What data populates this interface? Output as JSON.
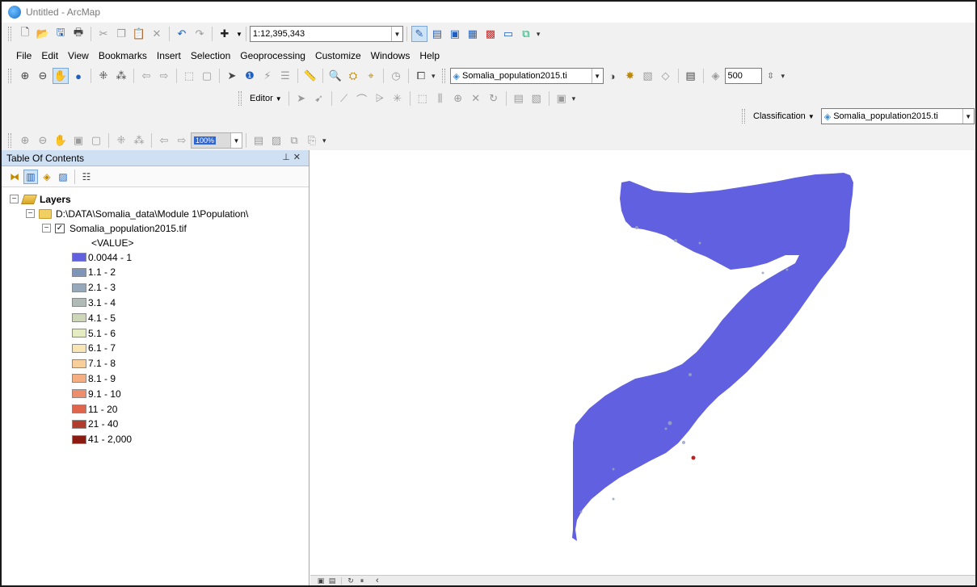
{
  "window": {
    "title": "Untitled - ArcMap"
  },
  "standard_toolbar": {
    "scale_value": "1:12,395,343"
  },
  "menu": {
    "items": [
      "File",
      "Edit",
      "View",
      "Bookmarks",
      "Insert",
      "Selection",
      "Geoprocessing",
      "Customize",
      "Windows",
      "Help"
    ]
  },
  "tools_toolbar": {
    "layer_combo": "Somalia_population2015.ti",
    "resolution_value": "500"
  },
  "editor_toolbar": {
    "label": "Editor"
  },
  "classification_toolbar": {
    "label": "Classification",
    "layer_combo": "Somalia_population2015.ti"
  },
  "effects_toolbar": {
    "zoom_value": "100%"
  },
  "toc": {
    "title": "Table Of Contents",
    "root_label": "Layers",
    "group_path": "D:\\DATA\\Somalia_data\\Module 1\\Population\\",
    "layer_name": "Somalia_population2015.tif",
    "field_label": "<VALUE>",
    "legend": [
      {
        "label": "0.0044 - 1",
        "color": "#6161e0"
      },
      {
        "label": "1.1 - 2",
        "color": "#8096b8"
      },
      {
        "label": "2.1 - 3",
        "color": "#97a8ba"
      },
      {
        "label": "3.1 - 4",
        "color": "#b0bbb8"
      },
      {
        "label": "4.1 - 5",
        "color": "#cdd6b6"
      },
      {
        "label": "5.1 - 6",
        "color": "#e5ebc2"
      },
      {
        "label": "6.1 - 7",
        "color": "#f7e6b4"
      },
      {
        "label": "7.1 - 8",
        "color": "#f8cf9a"
      },
      {
        "label": "8.1 - 9",
        "color": "#f4ae82"
      },
      {
        "label": "9.1 - 10",
        "color": "#ec8d6c"
      },
      {
        "label": "11 - 20",
        "color": "#e0654d"
      },
      {
        "label": "21 - 40",
        "color": "#b03c2b"
      },
      {
        "label": "41 - 2,000",
        "color": "#8b1a10"
      }
    ]
  },
  "map": {
    "fill_color": "#6060e0",
    "hotspot_color": "#c02020"
  }
}
